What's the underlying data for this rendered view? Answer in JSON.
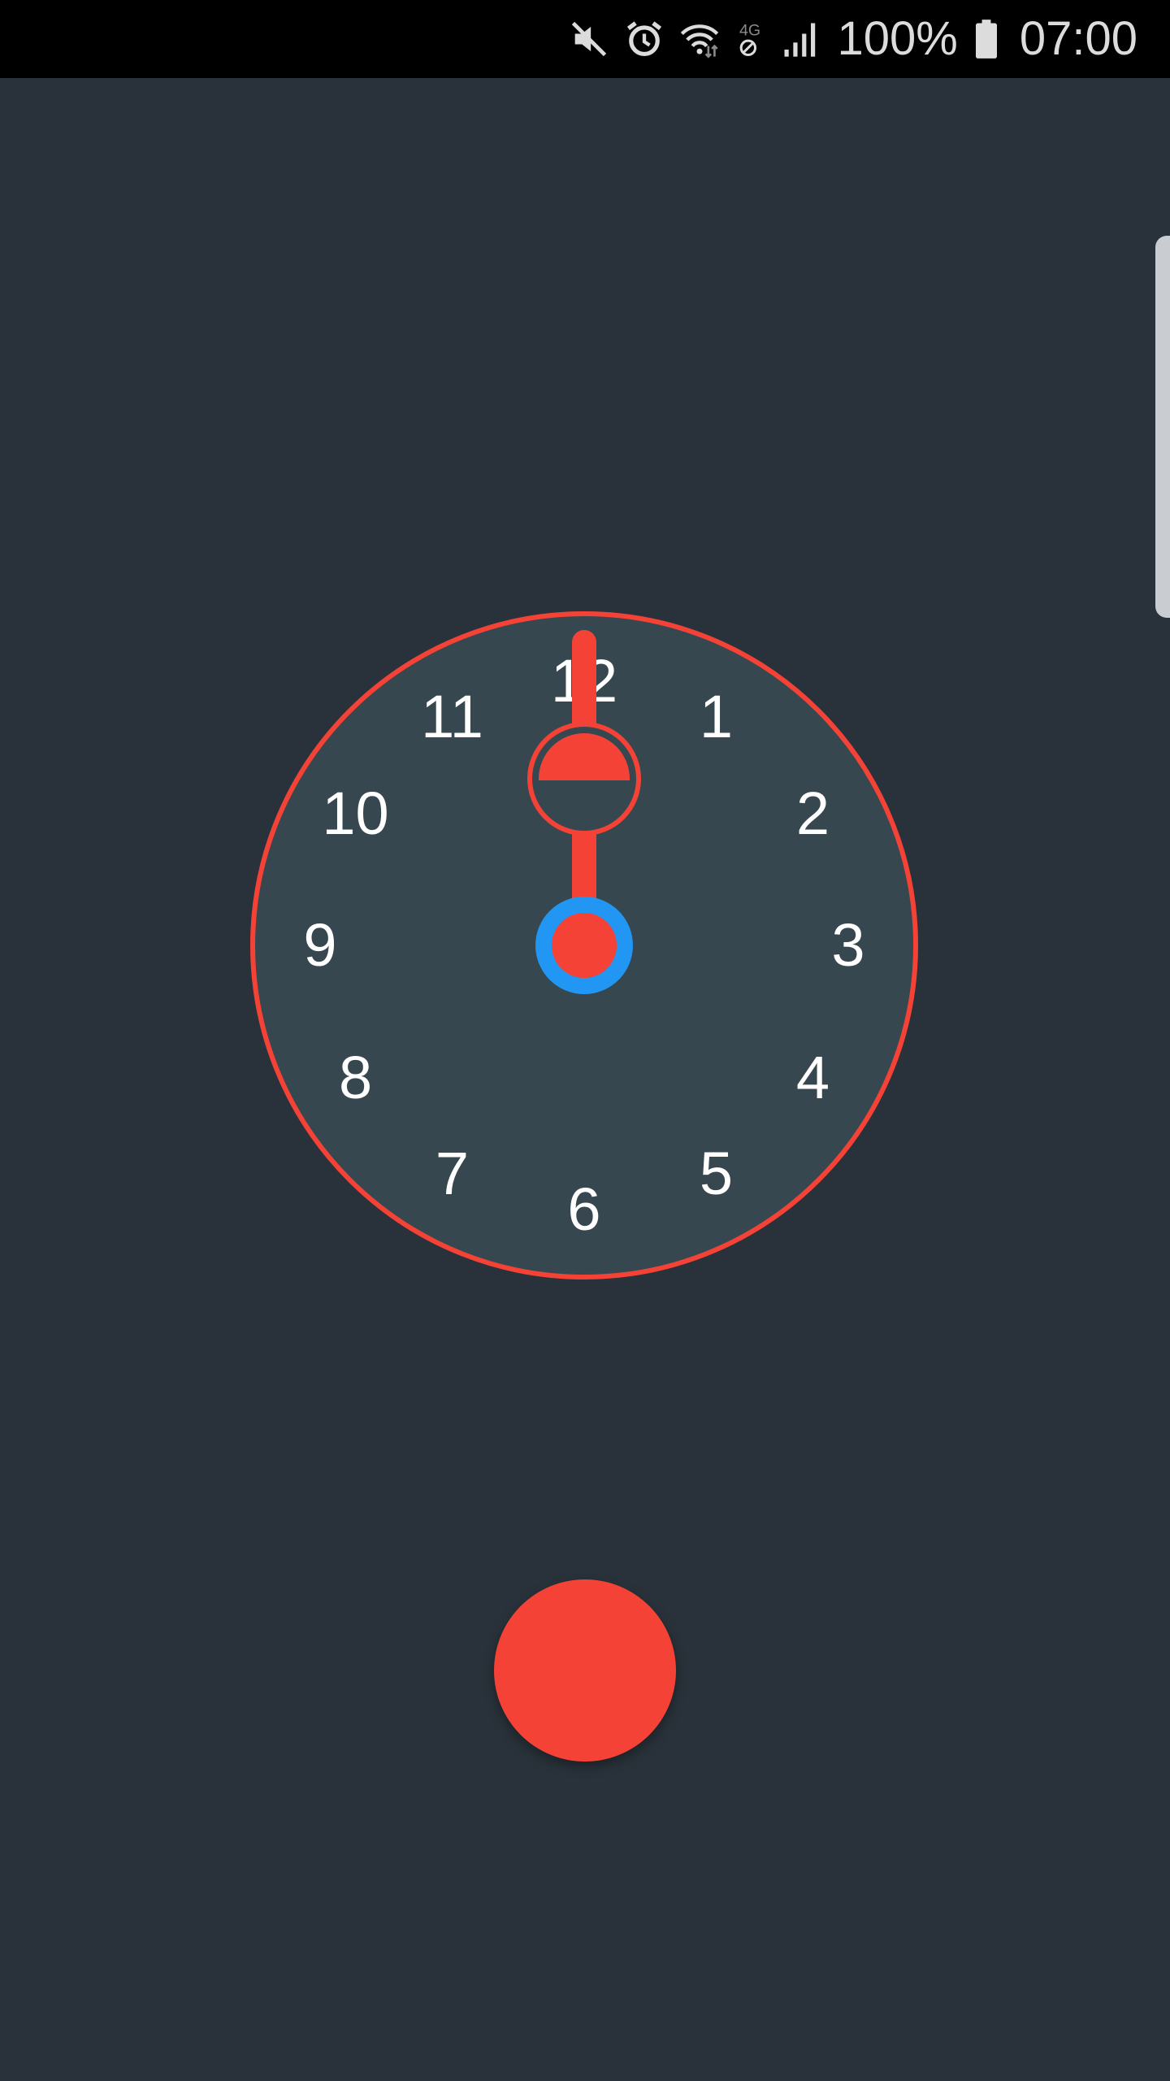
{
  "status_bar": {
    "icons": [
      "mute-icon",
      "alarm-icon",
      "wifi-icon",
      "4g-no-data-icon",
      "signal-icon",
      "battery-icon"
    ],
    "network_label": "4G",
    "battery_percent": "100%",
    "time": "07:00"
  },
  "clock": {
    "numbers": [
      "12",
      "1",
      "2",
      "3",
      "4",
      "5",
      "6",
      "7",
      "8",
      "9",
      "10",
      "11"
    ],
    "hand_hour": 12,
    "handle_fill_fraction": 0.5,
    "colors": {
      "ring": "#f44336",
      "face": "#37474f",
      "hand": "#f44336",
      "pivot_outer": "#2196f3",
      "pivot_inner": "#f44336"
    }
  },
  "record_button": {
    "color": "#f44336"
  },
  "colors": {
    "background": "#29323a",
    "status_bar": "#000000"
  }
}
